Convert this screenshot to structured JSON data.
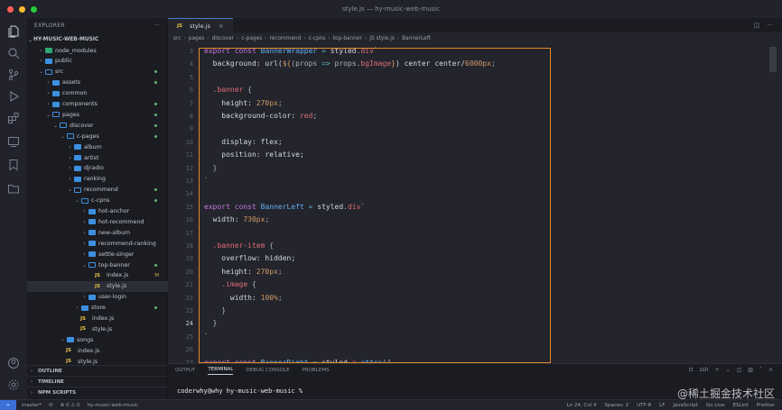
{
  "window_title": "style.js — hy-music-web-music",
  "explorer": {
    "header": "EXPLORER",
    "project": "HY-MUSIC-WEB-MUSIC",
    "tree": [
      {
        "label": "node_modules",
        "depth": 1,
        "kind": "folder",
        "open": false,
        "color": "green"
      },
      {
        "label": "public",
        "depth": 1,
        "kind": "folder",
        "open": false
      },
      {
        "label": "src",
        "depth": 1,
        "kind": "folder",
        "open": true,
        "dot": true
      },
      {
        "label": "assets",
        "depth": 2,
        "kind": "folder",
        "open": false,
        "dot": true
      },
      {
        "label": "common",
        "depth": 2,
        "kind": "folder",
        "open": false
      },
      {
        "label": "components",
        "depth": 2,
        "kind": "folder",
        "open": false,
        "dot": true
      },
      {
        "label": "pages",
        "depth": 2,
        "kind": "folder",
        "open": true,
        "dot": true
      },
      {
        "label": "discover",
        "depth": 3,
        "kind": "folder",
        "open": true,
        "dot": true
      },
      {
        "label": "c-pages",
        "depth": 4,
        "kind": "folder",
        "open": true,
        "dot": true
      },
      {
        "label": "album",
        "depth": 5,
        "kind": "folder",
        "open": false
      },
      {
        "label": "artist",
        "depth": 5,
        "kind": "folder",
        "open": false
      },
      {
        "label": "djradio",
        "depth": 5,
        "kind": "folder",
        "open": false
      },
      {
        "label": "ranking",
        "depth": 5,
        "kind": "folder",
        "open": false
      },
      {
        "label": "recommend",
        "depth": 5,
        "kind": "folder",
        "open": true,
        "dot": true
      },
      {
        "label": "c-cpns",
        "depth": 6,
        "kind": "folder",
        "open": true,
        "dot": true
      },
      {
        "label": "hot-anchor",
        "depth": 7,
        "kind": "folder",
        "open": false
      },
      {
        "label": "hot-recommend",
        "depth": 7,
        "kind": "folder",
        "open": false
      },
      {
        "label": "new-album",
        "depth": 7,
        "kind": "folder",
        "open": false
      },
      {
        "label": "recommend-ranking",
        "depth": 7,
        "kind": "folder",
        "open": false
      },
      {
        "label": "settle-singer",
        "depth": 7,
        "kind": "folder",
        "open": false
      },
      {
        "label": "top-banner",
        "depth": 7,
        "kind": "folder",
        "open": true,
        "dot": true
      },
      {
        "label": "index.js",
        "depth": 8,
        "kind": "js",
        "badge": "M"
      },
      {
        "label": "style.js",
        "depth": 8,
        "kind": "js",
        "active": true
      },
      {
        "label": "user-login",
        "depth": 7,
        "kind": "folder",
        "open": false
      },
      {
        "label": "store",
        "depth": 6,
        "kind": "folder",
        "open": false,
        "dot": true
      },
      {
        "label": "index.js",
        "depth": 6,
        "kind": "js"
      },
      {
        "label": "style.js",
        "depth": 6,
        "kind": "js"
      },
      {
        "label": "songs",
        "depth": 4,
        "kind": "folder",
        "open": false
      },
      {
        "label": "index.js",
        "depth": 4,
        "kind": "js"
      },
      {
        "label": "style.js",
        "depth": 4,
        "kind": "js"
      }
    ],
    "panels": [
      "OUTLINE",
      "TIMELINE",
      "NPM SCRIPTS"
    ]
  },
  "tab": {
    "label": "style.js"
  },
  "breadcrumb": [
    "src",
    "pages",
    "discover",
    "c-pages",
    "recommend",
    "c-cpns",
    "top-banner",
    "JS style.js",
    "BannerLeft"
  ],
  "code": {
    "line_numbers": [
      "3",
      "4",
      "5",
      "6",
      "7",
      "8",
      "9",
      "10",
      "11",
      "12",
      "13",
      "14",
      "15",
      "16",
      "17",
      "18",
      "19",
      "20",
      "21",
      "22",
      "23",
      "24",
      "25",
      "26",
      "27"
    ],
    "current_line": "24",
    "lines": [
      [
        [
          "kw",
          "export "
        ],
        [
          "kw",
          "const "
        ],
        [
          "fn",
          "BannerWrapper "
        ],
        [
          "op",
          "= "
        ],
        [
          "prop",
          "styled"
        ],
        [
          "pun",
          "."
        ],
        [
          "sel",
          "div"
        ],
        [
          "str",
          "`"
        ]
      ],
      [
        [
          "prop",
          "  background: url("
        ],
        [
          "num",
          "${"
        ],
        [
          "pun",
          "(props "
        ],
        [
          "op",
          "=> "
        ],
        [
          "pun",
          "props."
        ],
        [
          "sel",
          "bgImage"
        ],
        [
          "num",
          "}"
        ],
        [
          "prop",
          ") center center/"
        ],
        [
          "num",
          "6000px"
        ],
        [
          "pun",
          ";"
        ]
      ],
      [],
      [
        [
          "sel",
          "  .banner "
        ],
        [
          "pun",
          "{"
        ]
      ],
      [
        [
          "prop",
          "    height: "
        ],
        [
          "num",
          "270px"
        ],
        [
          "pun",
          ";"
        ]
      ],
      [
        [
          "prop",
          "    background-color: "
        ],
        [
          "sel",
          "red"
        ],
        [
          "pun",
          ";"
        ]
      ],
      [],
      [
        [
          "prop",
          "    display: flex;"
        ]
      ],
      [
        [
          "prop",
          "    position: relative;"
        ]
      ],
      [
        [
          "pun",
          "  }"
        ]
      ],
      [
        [
          "str",
          "`"
        ]
      ],
      [],
      [
        [
          "kw",
          "export "
        ],
        [
          "kw",
          "const "
        ],
        [
          "fn",
          "BannerLeft "
        ],
        [
          "op",
          "= "
        ],
        [
          "prop",
          "styled"
        ],
        [
          "pun",
          "."
        ],
        [
          "sel",
          "div"
        ],
        [
          "str",
          "`"
        ]
      ],
      [
        [
          "prop",
          "  width: "
        ],
        [
          "num",
          "730px"
        ],
        [
          "pun",
          ";"
        ]
      ],
      [],
      [
        [
          "sel",
          "  .banner-item "
        ],
        [
          "pun",
          "{"
        ]
      ],
      [
        [
          "prop",
          "    overflow: hidden;"
        ]
      ],
      [
        [
          "prop",
          "    height: "
        ],
        [
          "num",
          "270px"
        ],
        [
          "pun",
          ";"
        ]
      ],
      [
        [
          "sel",
          "    .image "
        ],
        [
          "pun",
          "{"
        ]
      ],
      [
        [
          "prop",
          "      width: "
        ],
        [
          "num",
          "100%"
        ],
        [
          "pun",
          ";"
        ]
      ],
      [
        [
          "pun",
          "    }"
        ]
      ],
      [
        [
          "pun",
          "  }"
        ]
      ],
      [
        [
          "str",
          "`"
        ]
      ],
      [],
      [
        [
          "kw",
          "export "
        ],
        [
          "kw",
          "const "
        ],
        [
          "fn",
          "BannerRight "
        ],
        [
          "op",
          "= "
        ],
        [
          "prop",
          "styled"
        ],
        [
          "pun",
          "."
        ],
        [
          "sel",
          "a"
        ],
        [
          "pun",
          "."
        ],
        [
          "fn",
          "attrs"
        ],
        [
          "pun",
          "({"
        ]
      ]
    ]
  },
  "panel": {
    "tabs": [
      "OUTPUT",
      "TERMINAL",
      "DEBUG CONSOLE",
      "PROBLEMS"
    ],
    "active_tab": "TERMINAL",
    "shell": "zsh",
    "prompt": "coderwhy@why hy-music-web-music %"
  },
  "status": {
    "branch": "master*",
    "errors": "⊗ 0 ⚠ 0",
    "folder": "hy-music-web-music",
    "right": [
      "Ln 24, Col 4",
      "Spaces: 2",
      "UTF-8",
      "LF",
      "JavaScript",
      "Go Live",
      "ESLint",
      "Prettier"
    ]
  },
  "watermark": "@稀土掘金技术社区",
  "colors": {
    "accent": "#3d6fd8",
    "highlight_box": "#e48a2a",
    "folder": "#3d8fe0"
  }
}
